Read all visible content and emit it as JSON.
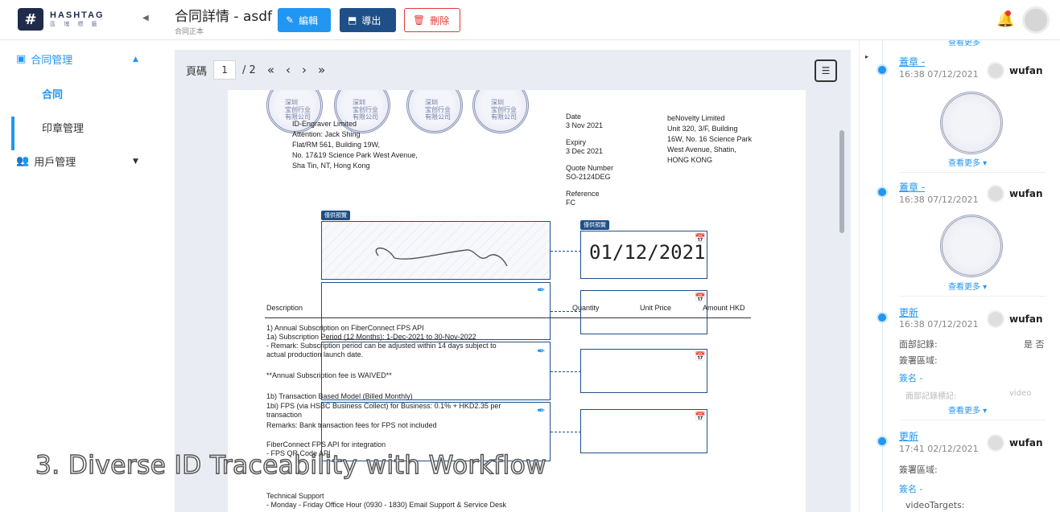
{
  "brand": {
    "name": "HASHTAG",
    "sub": "區 塊 標 籤"
  },
  "header": {
    "title": "合同詳情 - asdf",
    "subtitle": "合同正本",
    "edit_label": "編輯",
    "export_label": "導出",
    "delete_label": "刪除"
  },
  "sidebar": {
    "contract_mgmt": "合同管理",
    "contract": "合同",
    "seal_mgmt": "印章管理",
    "user_mgmt": "用戶管理"
  },
  "pager": {
    "label": "頁碼",
    "current": "1",
    "total": "/ 2"
  },
  "doc": {
    "stamp_text": "深圳\n宝创行业\n有限公司",
    "to_lines": [
      "ID-Engraver Limited",
      "Attention: Jack Shing",
      "Flat/RM 561, Building 19W,",
      "No. 17&19 Science Park West Avenue,",
      "Sha Tin, NT, Hong Kong"
    ],
    "date_label": "Date",
    "date": "3 Nov 2021",
    "expiry_label": "Expiry",
    "expiry": "3 Dec 2021",
    "quote_label": "Quote Number",
    "quote": "SO-2124DEG",
    "ref_label": "Reference",
    "ref": "FC",
    "from_lines": [
      "beNovelty Limited",
      "Unit 320, 3/F, Building",
      "16W, No. 16 Science Park",
      "West Avenue, Shatin,",
      "HONG KONG"
    ],
    "sig_tag": "僅供預覽",
    "date_tag": "僅供預覽",
    "date_value": "01/12/2021",
    "col_desc": "Description",
    "col_qty": "Quantity",
    "col_unit": "Unit Price",
    "col_amount": "Amount HKD",
    "lines": [
      "1) Annual Subscription on FiberConnect FPS API",
      "1a) Subscription Period (12 Months): 1-Dec-2021 to 30-Nov-2022",
      "- Remark: Subscription period can be adjusted within 14 days subject to",
      "actual production launch date.",
      "",
      "**Annual Subscription fee is WAIVED**",
      "",
      "1b) Transaction Based Model (Billed Monthly)",
      "1bi) FPS (via HSBC Business Collect) for Business: 0.1% + HKD2.35 per",
      "transaction",
      "Remarks: Bank transaction fees for FPS not included",
      "",
      "FiberConnect FPS API for integration",
      "- FPS QR Code API"
    ],
    "support_lines": [
      "Technical Support",
      "- Monday - Friday Office Hour (0930 - 1830) Email Support & Service Desk"
    ]
  },
  "caption": "3. Diverse ID Traceability with Workflow",
  "timeline": {
    "top_more": "查看更多",
    "entries": [
      {
        "title": "蓋章 -",
        "time": "16:38 07/12/2021",
        "user": "wufan",
        "more": "查看更多"
      },
      {
        "title": "蓋章 -",
        "time": "16:38 07/12/2021",
        "user": "wufan",
        "more": "查看更多"
      },
      {
        "title": "更新",
        "time": "16:38 07/12/2021",
        "user": "wufan",
        "face_label": "面部記錄:",
        "face_value": "是 否",
        "sign_area": "簽署區域:",
        "sign": "簽名 -",
        "faded": "面部記錄標記:",
        "faded2": "video",
        "more": "查看更多"
      },
      {
        "title": "更新",
        "time": "17:41 02/12/2021",
        "user": "wufan",
        "sign_area": "簽署區域:",
        "sign": "簽名 -",
        "targets": "videoTargets:"
      }
    ]
  },
  "colors": {
    "primary": "#2196f3",
    "navy": "#1f4f87",
    "danger": "#e53935"
  }
}
